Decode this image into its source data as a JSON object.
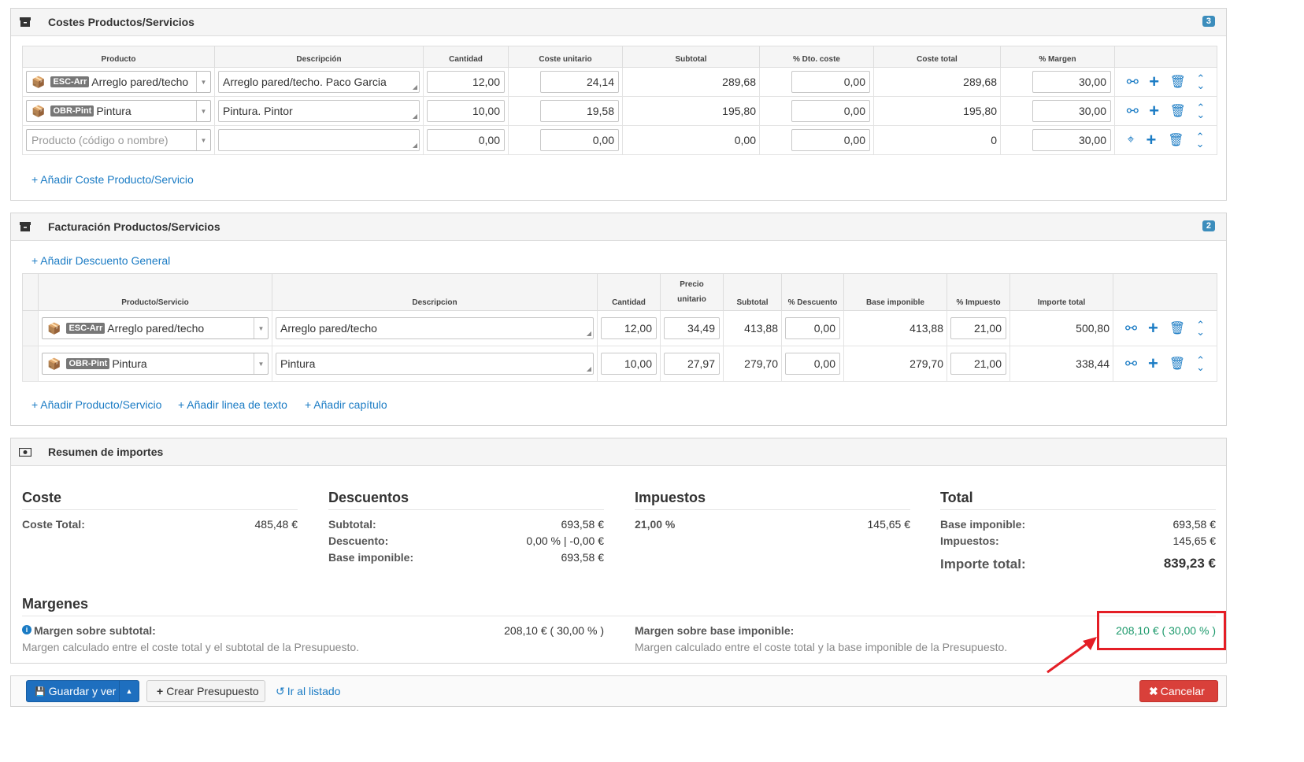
{
  "costes": {
    "title": "Costes Productos/Servicios",
    "badge": "3",
    "headers": [
      "Producto",
      "Descripción",
      "Cantidad",
      "Coste unitario",
      "Subtotal",
      "% Dto. coste",
      "Coste total",
      "% Margen"
    ],
    "rows": [
      {
        "code": "ESC-Arr",
        "product": "Arreglo pared/techo",
        "description": "Arreglo pared/techo. Paco Garcia",
        "cantidad": "12,00",
        "coste_unitario": "24,14",
        "subtotal": "289,68",
        "dto": "0,00",
        "coste_total": "289,68",
        "margen": "30,00"
      },
      {
        "code": "OBR-Pint",
        "product": "Pintura",
        "description": "Pintura. Pintor",
        "cantidad": "10,00",
        "coste_unitario": "19,58",
        "subtotal": "195,80",
        "dto": "0,00",
        "coste_total": "195,80",
        "margen": "30,00"
      }
    ],
    "empty_row": {
      "placeholder": "Producto (código o nombre)",
      "cantidad": "0,00",
      "coste_unitario": "0,00",
      "subtotal": "0,00",
      "dto": "0,00",
      "coste_total": "0",
      "margen": "30,00"
    },
    "add_link": "+ Añadir Coste Producto/Servicio"
  },
  "facturacion": {
    "title": "Facturación Productos/Servicios",
    "badge": "2",
    "add_discount": "+ Añadir Descuento General",
    "headers": {
      "producto": "Producto/Servicio",
      "descripcion": "Descripcion",
      "cantidad": "Cantidad",
      "precio_1": "Precio",
      "precio_2": "unitario",
      "subtotal": "Subtotal",
      "descuento": "% Descuento",
      "base": "Base imponible",
      "impuesto": "% Impuesto",
      "importe": "Importe total"
    },
    "rows": [
      {
        "code": "ESC-Arr",
        "product": "Arreglo pared/techo",
        "description": "Arreglo pared/techo",
        "cantidad": "12,00",
        "precio": "34,49",
        "subtotal": "413,88",
        "descuento": "0,00",
        "base": "413,88",
        "impuesto": "21,00",
        "importe": "500,80"
      },
      {
        "code": "OBR-Pint",
        "product": "Pintura",
        "description": "Pintura",
        "cantidad": "10,00",
        "precio": "27,97",
        "subtotal": "279,70",
        "descuento": "0,00",
        "base": "279,70",
        "impuesto": "21,00",
        "importe": "338,44"
      }
    ],
    "links": [
      "+ Añadir Producto/Servicio",
      "+ Añadir linea de texto",
      "+ Añadir capítulo"
    ]
  },
  "resumen": {
    "title": "Resumen de importes",
    "coste": {
      "heading": "Coste",
      "total_label": "Coste Total:",
      "total_value": "485,48 €"
    },
    "descuentos": {
      "heading": "Descuentos",
      "subtotal_label": "Subtotal:",
      "subtotal_value": "693,58 €",
      "descuento_label": "Descuento:",
      "descuento_value": "0,00 % | -0,00 €",
      "base_label": "Base imponible:",
      "base_value": "693,58 €"
    },
    "impuestos": {
      "heading": "Impuestos",
      "rate_label": "21,00 %",
      "rate_value": "145,65 €"
    },
    "total": {
      "heading": "Total",
      "base_label": "Base imponible:",
      "base_value": "693,58 €",
      "imp_label": "Impuestos:",
      "imp_value": "145,65 €",
      "importe_label": "Importe total:",
      "importe_value": "839,23 €"
    },
    "margenes": {
      "heading": "Margenes",
      "subtotal_label": "Margen sobre subtotal:",
      "subtotal_value": "208,10 € ( 30,00 % )",
      "subtotal_desc": "Margen calculado entre el coste total y el subtotal de la Presupuesto.",
      "base_label": "Margen sobre base imponible:",
      "base_value": "208,10 € ( 30,00 % )",
      "base_desc": "Margen calculado entre el coste total y la base imponible de la Presupuesto."
    }
  },
  "footer": {
    "save": "Guardar y ver",
    "create": "Crear Presupuesto",
    "list": "Ir al listado",
    "cancel": "Cancelar"
  },
  "colors": {
    "link": "#1a7bc4",
    "primary": "#1e6fbf",
    "danger": "#d9403a",
    "highlight": "#e41e26",
    "margin_value": "#1d9a6c"
  }
}
